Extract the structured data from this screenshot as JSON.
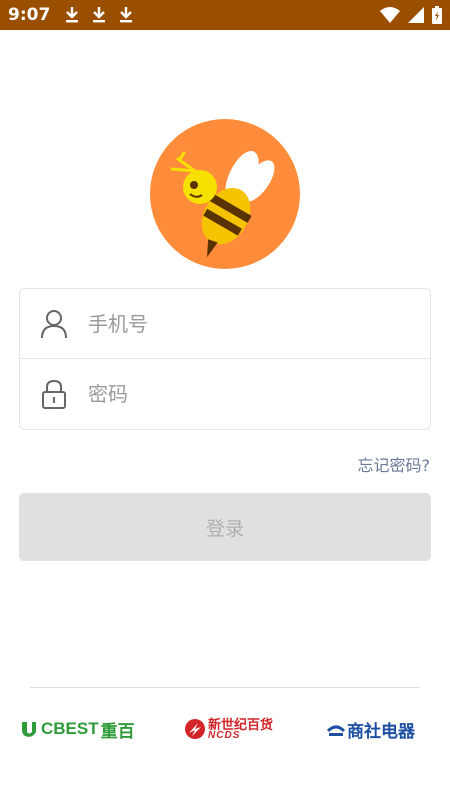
{
  "status_bar": {
    "time": "9:07",
    "left_icons": [
      "download-icon",
      "download-icon",
      "download-icon"
    ],
    "right_icons": [
      "wifi-icon",
      "signal-icon",
      "battery-icon"
    ]
  },
  "logo": {
    "icon": "bee-icon",
    "bg_color": "#ff8c3a"
  },
  "form": {
    "phone": {
      "icon": "user-icon",
      "placeholder": "手机号",
      "value": ""
    },
    "password": {
      "icon": "lock-icon",
      "placeholder": "密码",
      "value": ""
    }
  },
  "forgot_password": "忘记密码?",
  "login_button": "登录",
  "partners": {
    "cbest": {
      "latin": "CBEST",
      "cn": "重百",
      "color": "#2f9b3a"
    },
    "ncds": {
      "cn": "新世纪百货",
      "latin": "NCDS",
      "color": "#d2262a"
    },
    "shangshe": {
      "cn": "商社电器",
      "color": "#1d4fa3"
    }
  },
  "colors": {
    "status_bar": "#9a4f00",
    "button_disabled": "#e0e0e0",
    "link": "#6b7a99"
  }
}
